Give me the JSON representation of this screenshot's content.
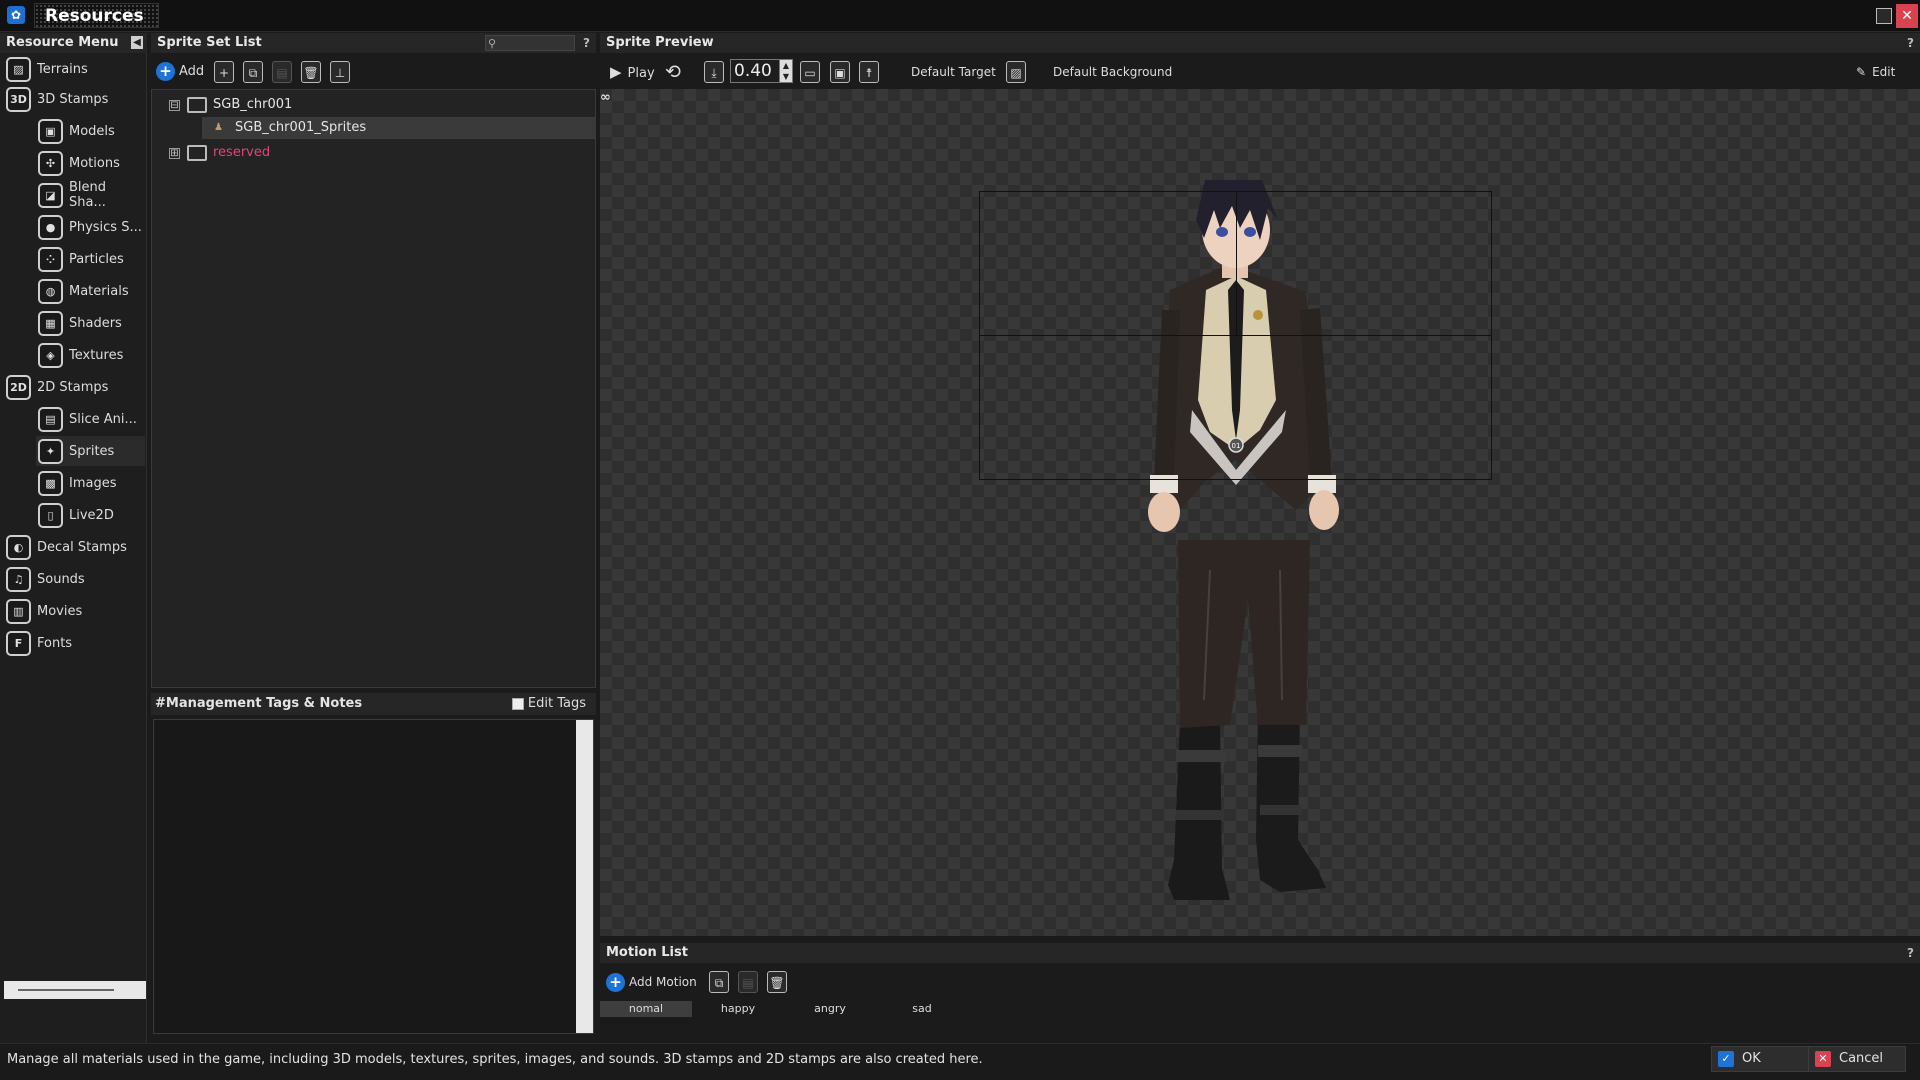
{
  "window": {
    "title": "Resources"
  },
  "resource_menu": {
    "title": "Resource Menu",
    "items": [
      {
        "label": "Terrains",
        "icon": "terrain-icon",
        "glyph": "▨"
      },
      {
        "label": "3D Stamps",
        "icon": "3d-stamp-icon",
        "glyph": "3D"
      },
      {
        "label": "Models",
        "icon": "model-icon",
        "glyph": "▣"
      },
      {
        "label": "Motions",
        "icon": "motion-icon",
        "glyph": "✣"
      },
      {
        "label": "Blend Sha...",
        "icon": "blend-shape-icon",
        "glyph": "◪"
      },
      {
        "label": "Physics S...",
        "icon": "physics-icon",
        "glyph": "●"
      },
      {
        "label": "Particles",
        "icon": "particle-icon",
        "glyph": "⁘"
      },
      {
        "label": "Materials",
        "icon": "material-icon",
        "glyph": "◍"
      },
      {
        "label": "Shaders",
        "icon": "shader-icon",
        "glyph": "▦"
      },
      {
        "label": "Textures",
        "icon": "texture-icon",
        "glyph": "◈"
      },
      {
        "label": "2D Stamps",
        "icon": "2d-stamp-icon",
        "glyph": "2D"
      },
      {
        "label": "Slice Ani...",
        "icon": "slice-anim-icon",
        "glyph": "▤"
      },
      {
        "label": "Sprites",
        "icon": "sprite-icon",
        "glyph": "✦"
      },
      {
        "label": "Images",
        "icon": "image-icon",
        "glyph": "▩"
      },
      {
        "label": "Live2D",
        "icon": "live2d-icon",
        "glyph": "▯"
      },
      {
        "label": "Decal Stamps",
        "icon": "decal-icon",
        "glyph": "◐"
      },
      {
        "label": "Sounds",
        "icon": "sound-icon",
        "glyph": "♫"
      },
      {
        "label": "Movies",
        "icon": "movie-icon",
        "glyph": "▥"
      },
      {
        "label": "Fonts",
        "icon": "font-icon",
        "glyph": "F"
      }
    ],
    "selected": "Sprites"
  },
  "sprite_set_list": {
    "title": "Sprite Set List",
    "help": "?",
    "add_label": "Add",
    "tree": [
      {
        "label": "SGB_chr001",
        "toggle": "⊟",
        "color": "#e0e0e0"
      },
      {
        "label": "SGB_chr001_Sprites",
        "color": "#e8e8e8"
      },
      {
        "label": "reserved",
        "toggle": "⊞",
        "color": "#e0457a"
      }
    ]
  },
  "tags": {
    "title": "#Management Tags & Notes",
    "edit_tags_label": "Edit Tags"
  },
  "sprite_preview": {
    "title": "Sprite Preview",
    "help": "?",
    "play_label": "Play",
    "zoom": "0.40",
    "target_label": "Default Target",
    "background_label": "Default Background",
    "edit_label": "Edit",
    "anchor_label": "01"
  },
  "motion_list": {
    "title": "Motion List",
    "help": "?",
    "add_label": "Add Motion",
    "motions": [
      "nomal",
      "happy",
      "angry",
      "sad"
    ],
    "selected": "nomal"
  },
  "status": {
    "message": "Manage all materials used in the game, including 3D models, textures, sprites, images, and sounds. 3D stamps and 2D stamps are also created here.",
    "ok_label": "OK",
    "cancel_label": "Cancel"
  },
  "colors": {
    "accent_blue": "#1f73d6",
    "close_red": "#d8434f",
    "reserved_pink": "#e0457a"
  }
}
